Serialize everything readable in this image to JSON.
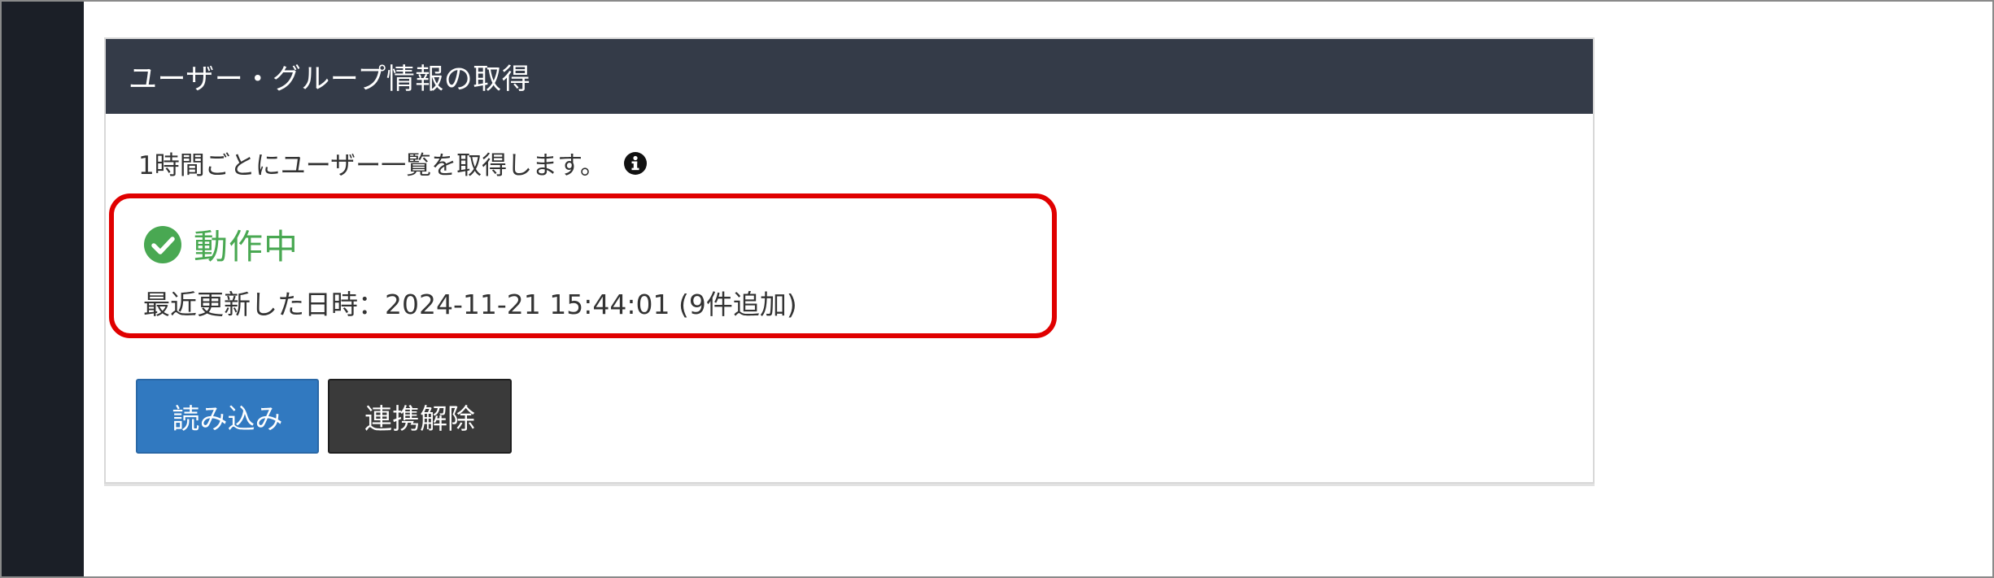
{
  "panel": {
    "title": "ユーザー・グループ情報の取得",
    "description": "1時間ごとにユーザー一覧を取得します。",
    "info_icon": "info-circle-icon"
  },
  "status": {
    "icon": "check-circle-icon",
    "label": "動作中",
    "color": "#49a852",
    "last_updated": "最近更新した日時：2024-11-21 15:44:01 (9件追加)"
  },
  "actions": {
    "load_label": "読み込み",
    "unlink_label": "連携解除"
  },
  "colors": {
    "header_bg": "#343b48",
    "sidebar_bg": "#1b1f27",
    "primary_button": "#3179c0",
    "dark_button": "#3a3a3a",
    "highlight_border": "#e00000"
  }
}
